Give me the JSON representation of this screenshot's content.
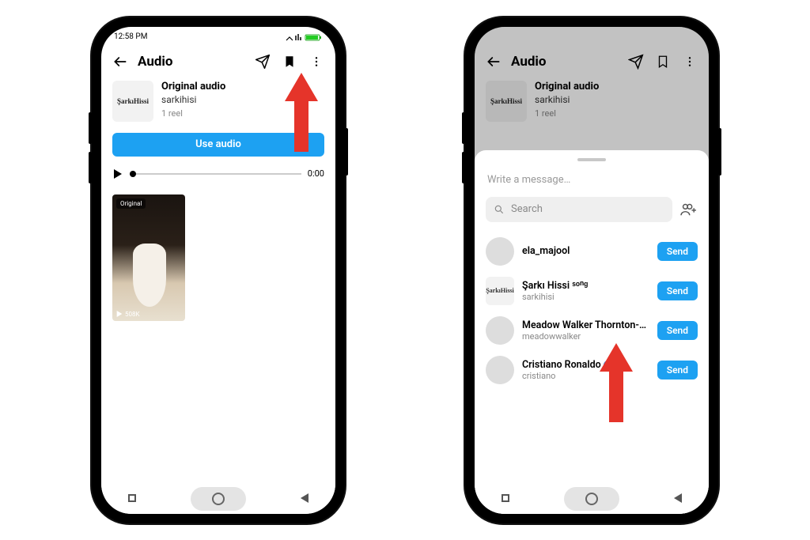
{
  "left": {
    "statusTime": "12:58 PM",
    "title": "Audio",
    "coverText": "ŞarkıHissi",
    "audio": {
      "title": "Original audio",
      "artist": "sarkihisi",
      "count": "1 reel"
    },
    "useAudio": "Use audio",
    "duration": "0:00",
    "reelBadge": "Original",
    "reelViews": "508K"
  },
  "right": {
    "title": "Audio",
    "coverText": "ŞarkıHissi",
    "audio": {
      "title": "Original audio",
      "artist": "sarkihisi",
      "count": "1 reel"
    },
    "sheet": {
      "messagePlaceholder": "Write a message…",
      "searchPlaceholder": "Search",
      "sendLabel": "Send",
      "contacts": [
        {
          "name": "ela_majool",
          "sub": "",
          "verified": false,
          "squareAvatar": false
        },
        {
          "name": "Şarkı Hissi ˢᵒⁿᵍ",
          "sub": "sarkihisi",
          "verified": false,
          "squareAvatar": true,
          "avatarText": "ŞarkıHissi"
        },
        {
          "name": "Meadow Walker Thornton-Allan…",
          "sub": "meadowwalker",
          "verified": false,
          "squareAvatar": false
        },
        {
          "name": "Cristiano Ronaldo",
          "sub": "cristiano",
          "verified": true,
          "squareAvatar": false
        }
      ]
    }
  }
}
